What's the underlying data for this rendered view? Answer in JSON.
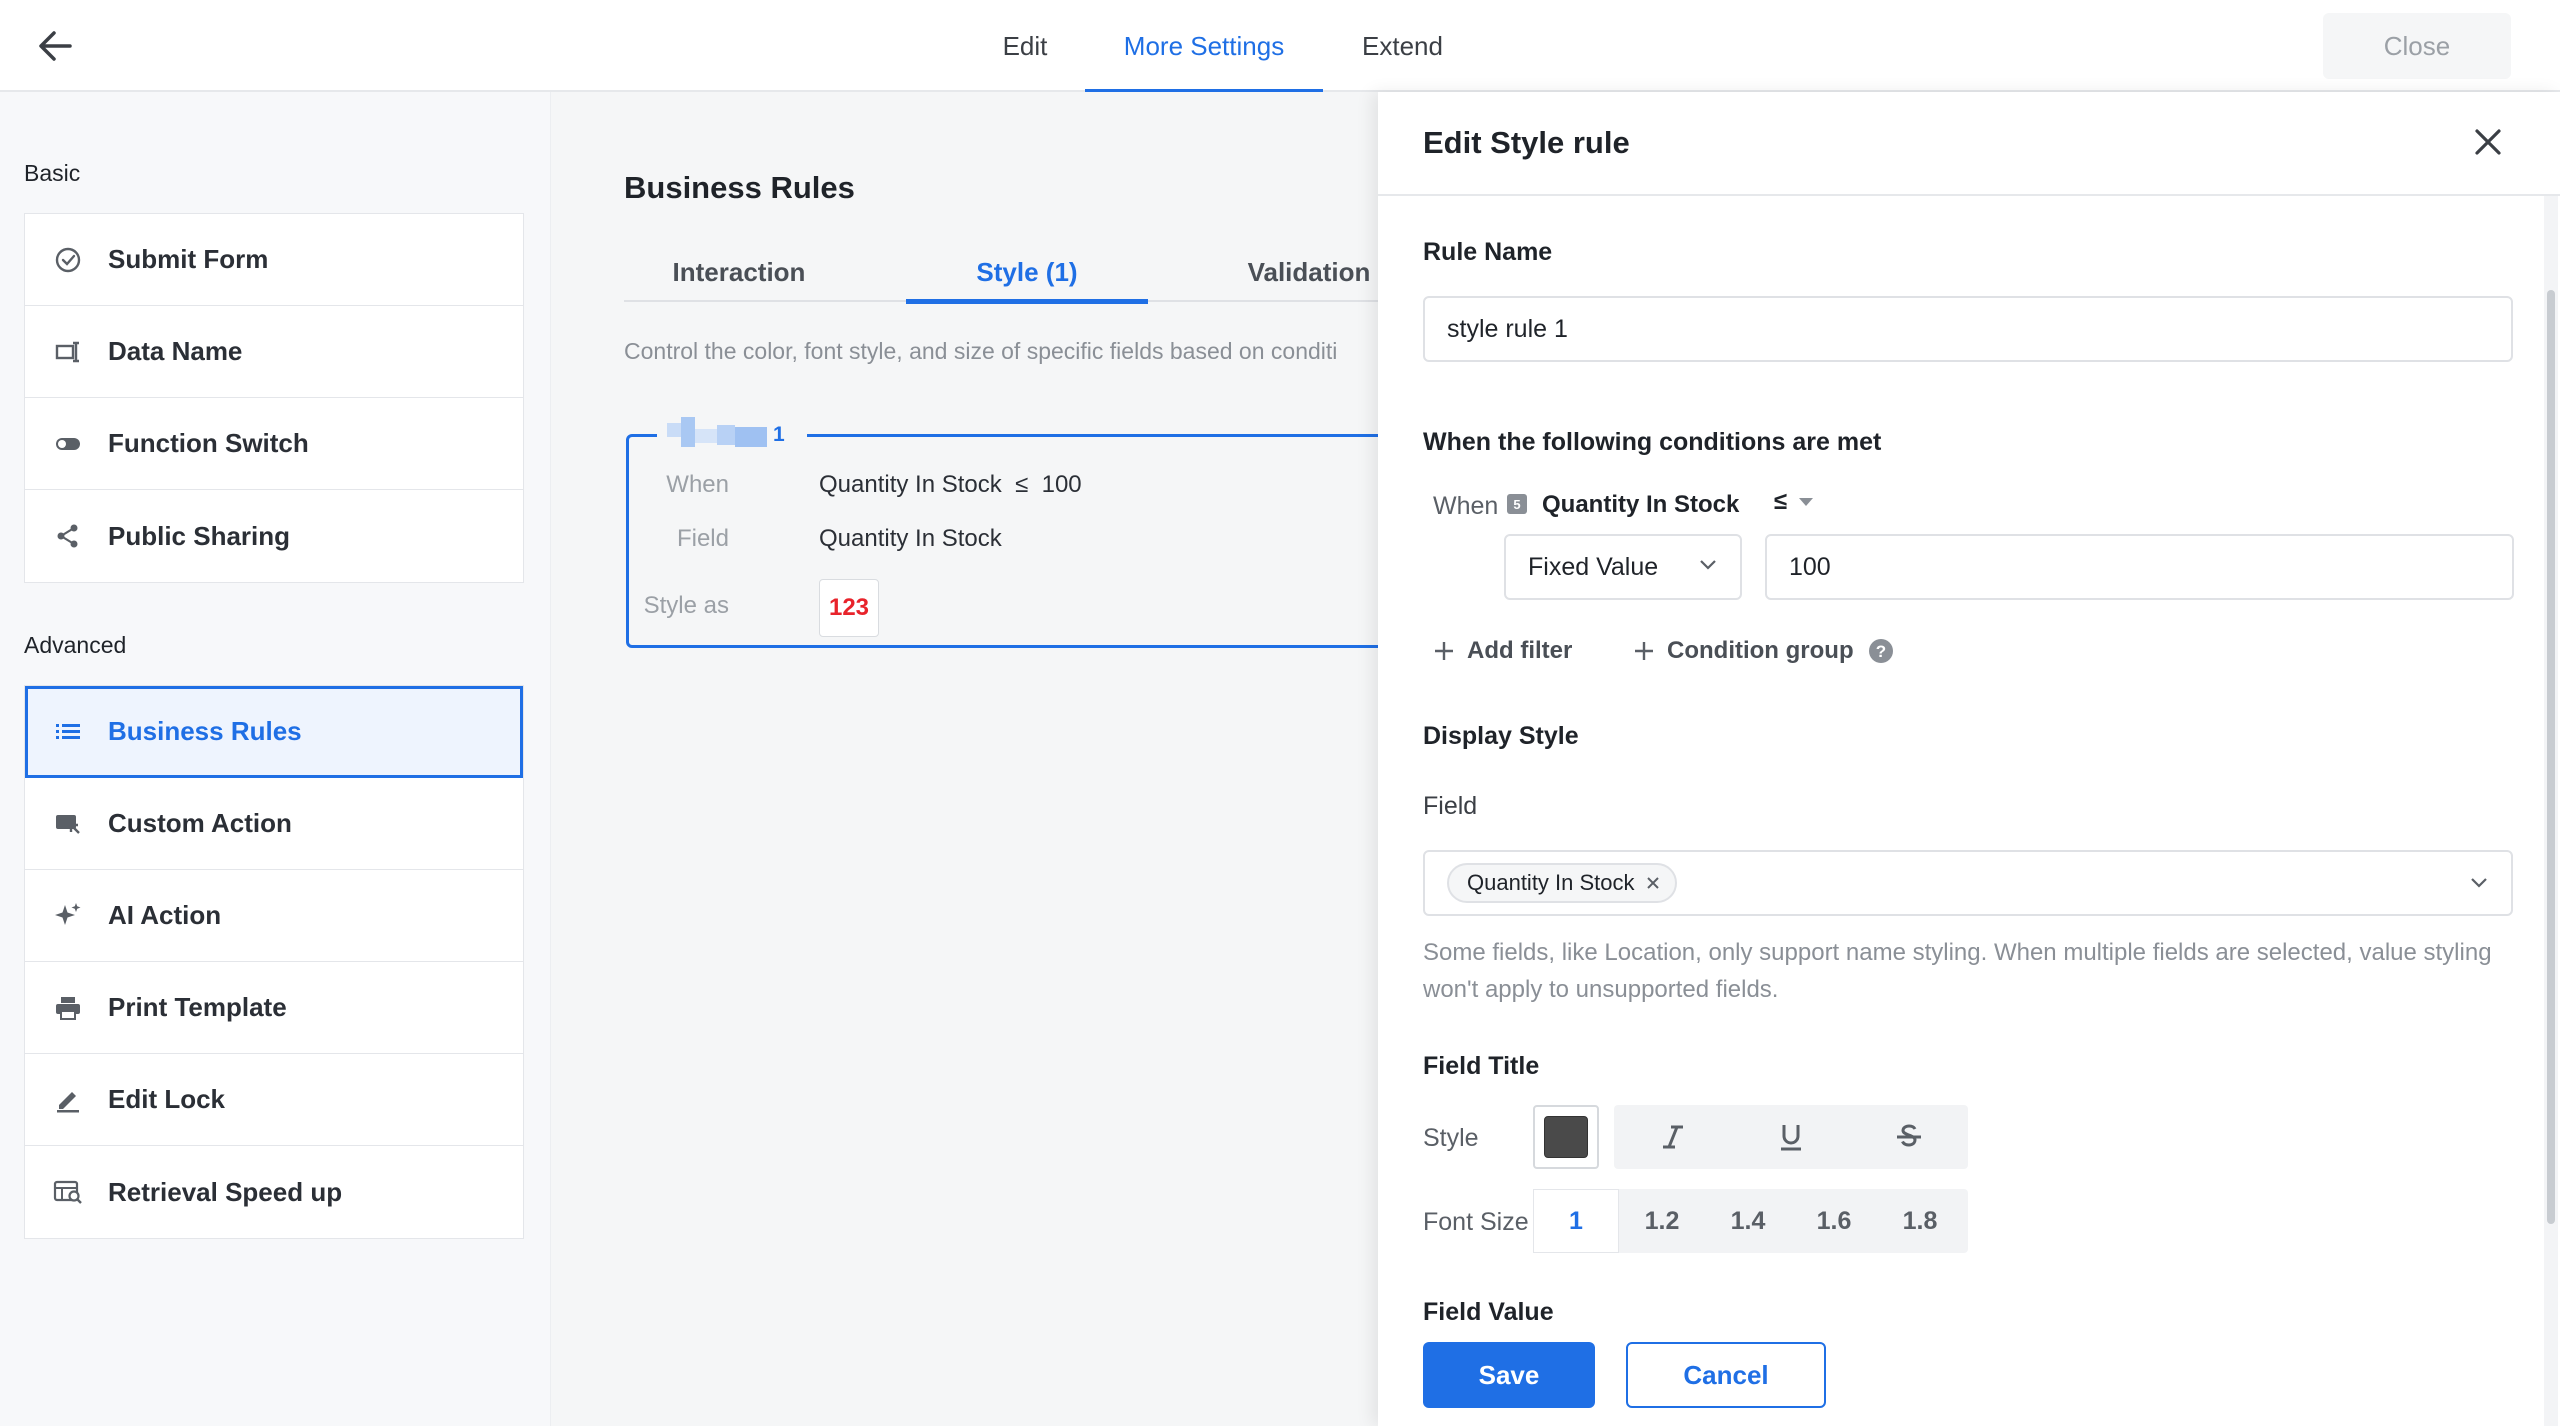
{
  "topbar": {
    "tabs": [
      {
        "label": "Edit"
      },
      {
        "label": "More Settings"
      },
      {
        "label": "Extend"
      }
    ],
    "close_label": "Close"
  },
  "sidebar": {
    "basic_label": "Basic",
    "basic_items": [
      {
        "label": "Submit Form",
        "icon": "check-circle-icon"
      },
      {
        "label": "Data Name",
        "icon": "data-name-icon"
      },
      {
        "label": "Function Switch",
        "icon": "toggle-icon"
      },
      {
        "label": "Public Sharing",
        "icon": "share-icon"
      }
    ],
    "advanced_label": "Advanced",
    "advanced_items": [
      {
        "label": "Business Rules",
        "icon": "list-icon",
        "active": true
      },
      {
        "label": "Custom Action",
        "icon": "custom-action-icon"
      },
      {
        "label": "AI Action",
        "icon": "sparkle-icon"
      },
      {
        "label": "Print Template",
        "icon": "printer-icon"
      },
      {
        "label": "Edit Lock",
        "icon": "pencil-icon"
      },
      {
        "label": "Retrieval Speed up",
        "icon": "retrieval-icon"
      }
    ]
  },
  "main": {
    "title": "Business Rules",
    "tabs": [
      {
        "label": "Interaction"
      },
      {
        "label": "Style (1)"
      },
      {
        "label": "Validation"
      }
    ],
    "description": "Control the color, font style, and size of specific fields based on conditi",
    "rule_card": {
      "number": "1",
      "when_key": "When",
      "when_value": "Quantity In Stock  ≤  100",
      "field_key": "Field",
      "field_value": "Quantity In Stock",
      "style_key": "Style as",
      "style_sample": "123"
    }
  },
  "drawer": {
    "title": "Edit Style rule",
    "rule_name_label": "Rule Name",
    "rule_name_value": "style rule 1",
    "conditions_label": "When the following conditions are met",
    "when_label": "When",
    "field_type_badge": "5",
    "condition_field": "Quantity In Stock",
    "operator": "≤",
    "value_type": "Fixed Value",
    "value": "100",
    "add_filter_label": "Add filter",
    "condition_group_label": "Condition group",
    "display_style_label": "Display Style",
    "field_label": "Field",
    "selected_field_tag": "Quantity In Stock",
    "hint": "Some fields, like Location, only support name styling. When multiple fields are selected, value styling won't apply to unsupported fields.",
    "field_title_label": "Field Title",
    "style_label": "Style",
    "font_size_label": "Font Size",
    "font_sizes": [
      "1",
      "1.2",
      "1.4",
      "1.6",
      "1.8"
    ],
    "field_value_label": "Field Value",
    "save_label": "Save",
    "cancel_label": "Cancel"
  },
  "colors": {
    "accent": "#1f6fe5",
    "danger_sample": "#e8232b",
    "swatch": "#4a4a4a"
  }
}
